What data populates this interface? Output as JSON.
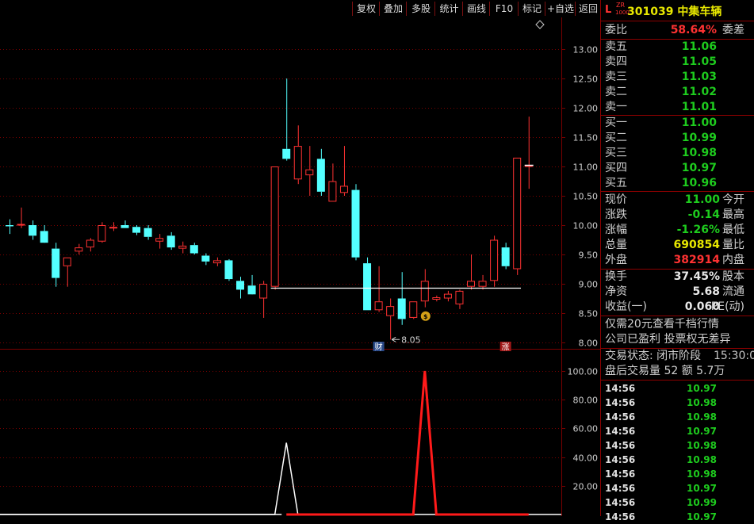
{
  "toolbar": {
    "buttons": [
      "复权",
      "叠加",
      "多股",
      "统计",
      "画线",
      "F10",
      "标记",
      "+自选",
      "返回"
    ]
  },
  "stock": {
    "prefix_l": "L",
    "badge_top": "ZR",
    "badge_bottom": "1000",
    "code_name": "301039 中集车辆"
  },
  "weibi": {
    "label": "委比",
    "value": "58.64%",
    "label2": "委差"
  },
  "asks": [
    {
      "label": "卖五",
      "price": "11.06"
    },
    {
      "label": "卖四",
      "price": "11.05"
    },
    {
      "label": "卖三",
      "price": "11.03"
    },
    {
      "label": "卖二",
      "price": "11.02"
    },
    {
      "label": "卖一",
      "price": "11.01"
    }
  ],
  "bids": [
    {
      "label": "买一",
      "price": "11.00"
    },
    {
      "label": "买二",
      "price": "10.99"
    },
    {
      "label": "买三",
      "price": "10.98"
    },
    {
      "label": "买四",
      "price": "10.97"
    },
    {
      "label": "买五",
      "price": "10.96"
    }
  ],
  "quote": [
    {
      "label": "现价",
      "value": "11.00",
      "color": "green",
      "label2": "今开"
    },
    {
      "label": "涨跌",
      "value": "-0.14",
      "color": "green",
      "label2": "最高"
    },
    {
      "label": "涨幅",
      "value": "-1.26%",
      "color": "green",
      "label2": "最低"
    },
    {
      "label": "总量",
      "value": "690854",
      "color": "yellow",
      "label2": "量比"
    },
    {
      "label": "外盘",
      "value": "382914",
      "color": "red",
      "label2": "内盘"
    }
  ],
  "fundamentals": [
    {
      "label": "换手",
      "value": "37.45%",
      "label2": "股本"
    },
    {
      "label": "净资",
      "value": "5.68",
      "label2": "流通"
    },
    {
      "label": "收益(一)",
      "value": "0.060",
      "label2": "PE(动)"
    }
  ],
  "notices": [
    "仅需20元查看千档行情",
    "公司已盈利 投票权无差异"
  ],
  "trade_status": {
    "label": "交易状态: 闭市阶段",
    "time": "15:30:0"
  },
  "after_hours": "盘后交易量 52 额 5.7万",
  "ticks": [
    {
      "time": "14:56",
      "price": "10.97"
    },
    {
      "time": "14:56",
      "price": "10.98"
    },
    {
      "time": "14:56",
      "price": "10.98"
    },
    {
      "time": "14:56",
      "price": "10.97"
    },
    {
      "time": "14:56",
      "price": "10.98"
    },
    {
      "time": "14:56",
      "price": "10.98"
    },
    {
      "time": "14:56",
      "price": "10.98"
    },
    {
      "time": "14:56",
      "price": "10.97"
    },
    {
      "time": "14:56",
      "price": "10.99"
    },
    {
      "time": "14:56",
      "price": "10.97"
    }
  ],
  "colors": {
    "up": "#ff3232",
    "down": "#54ffff",
    "grid": "#7a0000",
    "axis_text": "#d0d0d0"
  },
  "chart_data": [
    {
      "type": "candlestick",
      "ylim": [
        7.9,
        13.3
      ],
      "y_ticks": [
        "13.00",
        "12.50",
        "12.00",
        "11.50",
        "11.00",
        "10.50",
        "10.00",
        "9.50",
        "9.00",
        "8.50",
        "8.00"
      ],
      "low_annotation": "8.05",
      "markers": [
        {
          "index": 32,
          "text": "财"
        },
        {
          "index": 43,
          "text": "涨"
        }
      ],
      "reference_level": 8.93,
      "candles": [
        {
          "o": 10.0,
          "h": 10.1,
          "l": 9.85,
          "c": 9.98
        },
        {
          "o": 10.0,
          "h": 10.3,
          "l": 9.95,
          "c": 10.02
        },
        {
          "o": 10.0,
          "h": 10.08,
          "l": 9.75,
          "c": 9.82
        },
        {
          "o": 9.9,
          "h": 10.0,
          "l": 9.75,
          "c": 9.7
        },
        {
          "o": 9.6,
          "h": 9.7,
          "l": 8.95,
          "c": 9.1
        },
        {
          "o": 9.3,
          "h": 9.45,
          "l": 8.95,
          "c": 9.45
        },
        {
          "o": 9.55,
          "h": 9.68,
          "l": 9.5,
          "c": 9.62
        },
        {
          "o": 9.62,
          "h": 9.78,
          "l": 9.55,
          "c": 9.75
        },
        {
          "o": 9.72,
          "h": 10.05,
          "l": 9.7,
          "c": 10.0
        },
        {
          "o": 9.95,
          "h": 10.05,
          "l": 9.9,
          "c": 9.97
        },
        {
          "o": 10.0,
          "h": 10.08,
          "l": 9.95,
          "c": 9.95
        },
        {
          "o": 9.97,
          "h": 10.0,
          "l": 9.83,
          "c": 9.87
        },
        {
          "o": 9.95,
          "h": 10.0,
          "l": 9.75,
          "c": 9.8
        },
        {
          "o": 9.72,
          "h": 9.85,
          "l": 9.6,
          "c": 9.78
        },
        {
          "o": 9.82,
          "h": 9.88,
          "l": 9.58,
          "c": 9.62
        },
        {
          "o": 9.6,
          "h": 9.72,
          "l": 9.52,
          "c": 9.65
        },
        {
          "o": 9.66,
          "h": 9.7,
          "l": 9.5,
          "c": 9.52
        },
        {
          "o": 9.48,
          "h": 9.52,
          "l": 9.32,
          "c": 9.38
        },
        {
          "o": 9.35,
          "h": 9.45,
          "l": 9.3,
          "c": 9.4
        },
        {
          "o": 9.4,
          "h": 9.42,
          "l": 9.05,
          "c": 9.08
        },
        {
          "o": 9.05,
          "h": 9.12,
          "l": 8.75,
          "c": 8.9
        },
        {
          "o": 8.97,
          "h": 9.15,
          "l": 8.85,
          "c": 8.82
        },
        {
          "o": 8.75,
          "h": 9.05,
          "l": 8.42,
          "c": 9.0
        },
        {
          "o": 8.95,
          "h": 9.05,
          "l": 8.9,
          "c": 11.0
        },
        {
          "o": 11.3,
          "h": 12.5,
          "l": 11.1,
          "c": 11.13
        },
        {
          "o": 10.78,
          "h": 11.7,
          "l": 10.7,
          "c": 11.35
        },
        {
          "o": 10.85,
          "h": 11.35,
          "l": 10.5,
          "c": 10.95
        },
        {
          "o": 11.13,
          "h": 11.3,
          "l": 10.5,
          "c": 10.57
        },
        {
          "o": 10.4,
          "h": 11.05,
          "l": 10.4,
          "c": 10.75
        },
        {
          "o": 10.55,
          "h": 11.35,
          "l": 10.5,
          "c": 10.67
        },
        {
          "o": 10.6,
          "h": 10.7,
          "l": 9.4,
          "c": 9.45
        },
        {
          "o": 9.35,
          "h": 9.45,
          "l": 8.55,
          "c": 8.55
        },
        {
          "o": 8.55,
          "h": 9.3,
          "l": 8.52,
          "c": 8.7
        },
        {
          "o": 8.45,
          "h": 8.75,
          "l": 8.05,
          "c": 8.62
        },
        {
          "o": 8.75,
          "h": 9.2,
          "l": 8.3,
          "c": 8.4
        },
        {
          "o": 8.42,
          "h": 8.7,
          "l": 8.4,
          "c": 8.7
        },
        {
          "o": 8.7,
          "h": 9.25,
          "l": 8.6,
          "c": 9.05
        },
        {
          "o": 8.73,
          "h": 8.8,
          "l": 8.7,
          "c": 8.77
        },
        {
          "o": 8.75,
          "h": 8.88,
          "l": 8.7,
          "c": 8.83
        },
        {
          "o": 8.65,
          "h": 8.9,
          "l": 8.57,
          "c": 8.88
        },
        {
          "o": 8.95,
          "h": 9.5,
          "l": 8.9,
          "c": 9.05
        },
        {
          "o": 8.95,
          "h": 9.15,
          "l": 8.9,
          "c": 9.05
        },
        {
          "o": 9.05,
          "h": 9.82,
          "l": 8.95,
          "c": 9.75
        },
        {
          "o": 9.62,
          "h": 9.7,
          "l": 9.25,
          "c": 9.3
        },
        {
          "o": 9.25,
          "h": 11.15,
          "l": 9.15,
          "c": 11.15
        },
        {
          "o": 11.0,
          "h": 11.85,
          "l": 10.62,
          "c": 11.02
        }
      ]
    },
    {
      "type": "line",
      "ylim": [
        0,
        105
      ],
      "y_ticks": [
        "100.00",
        "80.00",
        "60.00",
        "40.00",
        "20.00"
      ],
      "series": [
        {
          "color": "#ffffff",
          "values": [
            0,
            0,
            0,
            0,
            0,
            0,
            0,
            0,
            0,
            0,
            0,
            0,
            0,
            0,
            0,
            0,
            0,
            0,
            0,
            0,
            0,
            0,
            0,
            0,
            50,
            0,
            0,
            0,
            0,
            0,
            0,
            0,
            0,
            0,
            0,
            0,
            0,
            0,
            0,
            0,
            0,
            0,
            0,
            0,
            0,
            0
          ]
        },
        {
          "color": "#ff1a1a",
          "values": [
            null,
            null,
            null,
            null,
            null,
            null,
            null,
            null,
            null,
            null,
            null,
            null,
            null,
            null,
            null,
            null,
            null,
            null,
            null,
            null,
            null,
            null,
            null,
            null,
            0,
            0,
            0,
            0,
            0,
            0,
            0,
            0,
            0,
            0,
            0,
            0,
            100,
            0,
            0,
            0,
            0,
            0,
            0,
            0,
            0,
            0
          ]
        }
      ]
    }
  ]
}
